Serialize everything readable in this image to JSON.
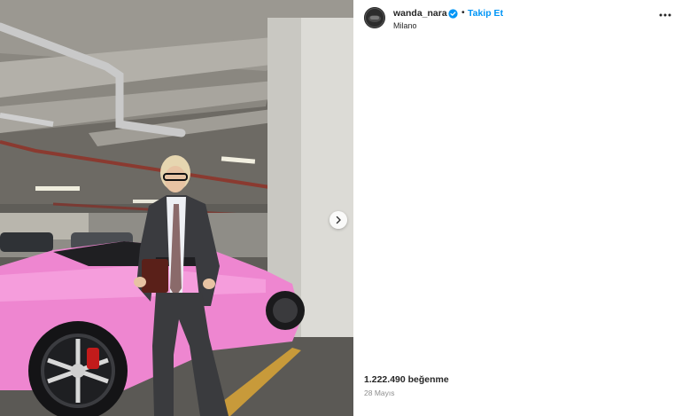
{
  "post": {
    "image_alt": "",
    "next_icon": "chevron-right-icon"
  },
  "header": {
    "username": "wanda_nara",
    "verified_icon": "verified-badge-icon",
    "separator": "•",
    "follow_label": "Takip Et",
    "location": "Milano",
    "more_icon": "more-options-icon"
  },
  "footer": {
    "likes": "1.222.490 beğenme",
    "date": "28 Mayıs"
  },
  "colors": {
    "accent": "#0095f6",
    "text": "#262626",
    "muted": "#8e8e8e"
  }
}
